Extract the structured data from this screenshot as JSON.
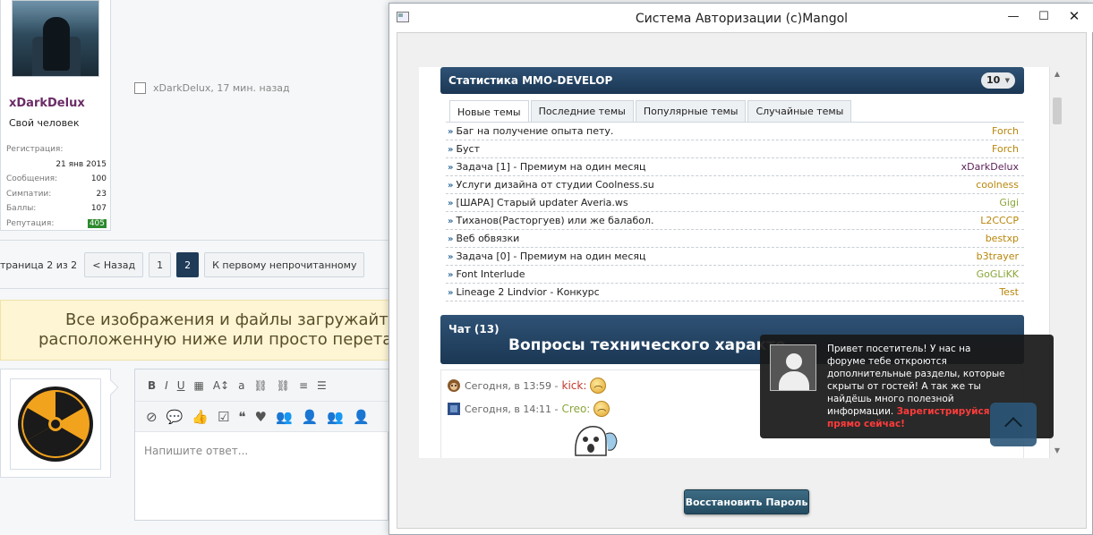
{
  "forum": {
    "user": {
      "name": "xDarkDelux",
      "title": "Свой человек",
      "stats": [
        {
          "label": "Регистрация:",
          "value": ""
        },
        {
          "label": "",
          "value": "21 янв 2015"
        },
        {
          "label": "Сообщения:",
          "value": "100"
        },
        {
          "label": "Симпатии:",
          "value": "23"
        },
        {
          "label": "Баллы:",
          "value": "107"
        },
        {
          "label": "Репутация:",
          "value": "405"
        }
      ]
    },
    "post_meta": "xDarkDelux, 17 мин. назад",
    "pagination": {
      "label": "траница 2 из 2",
      "prev": "< Назад",
      "pages": [
        "1",
        "2"
      ],
      "active_page": "2",
      "first_unread": "К первому непрочитанному"
    },
    "notice": {
      "line1": "Все изображения и файлы загружайте тольк",
      "line2": "расположенную ниже или просто перетащите к"
    },
    "editor": {
      "placeholder": "Напишите ответ..."
    }
  },
  "dialog": {
    "title": "Система Авторизации (c)Mangol",
    "stats_panel": {
      "title": "Статистика MMO-DEVELOP",
      "count": "10"
    },
    "tabs": [
      {
        "label": "Новые темы",
        "active": true
      },
      {
        "label": "Последние темы",
        "active": false
      },
      {
        "label": "Популярные темы",
        "active": false
      },
      {
        "label": "Случайные темы",
        "active": false
      }
    ],
    "topics": [
      {
        "title": "Баг на получение опыта пету.",
        "author": "Forch",
        "color": "#b8860b"
      },
      {
        "title": "Буст",
        "author": "Forch",
        "color": "#b8860b"
      },
      {
        "title": "Задача [1] - Премиум на один месяц",
        "author": "xDarkDelux",
        "color": "#5a1f57"
      },
      {
        "title": "Услуги дизайна от студии Coolness.su",
        "author": "coolness",
        "color": "#b8860b"
      },
      {
        "title": "[ШАРА] Старый updater Averia.ws",
        "author": "Gigi",
        "color": "#8aa63a"
      },
      {
        "title": "Тиханов(Расторгуев) или же балабол.",
        "author": "L2CCCP",
        "color": "#b8860b"
      },
      {
        "title": "Веб обвязки",
        "author": "bestxp",
        "color": "#b8860b"
      },
      {
        "title": "Задача [0] - Премиум на один месяц",
        "author": "b3trayer",
        "color": "#b8860b"
      },
      {
        "title": "Font Interlude",
        "author": "GoGLiKK",
        "color": "#8aa63a"
      },
      {
        "title": "Lineage 2 Lindvior - Конкурс",
        "author": "Test",
        "color": "#b8860b"
      }
    ],
    "chat": {
      "title": "Чат (13)",
      "banner": "Вопросы технического характе",
      "messages": [
        {
          "time": "Сегодня, в 13:59 -",
          "nick": "kick:",
          "nick_color": "#c0392b"
        },
        {
          "time": "Сегодня, в 14:11 -",
          "nick": "Creo:",
          "nick_color": "#8aa63a"
        }
      ]
    },
    "restore_button": "Восстановить Пароль"
  },
  "popup": {
    "text": "Привет посетитель! У нас на форуме тебе откроются дополнительные разделы, которые скрыты от гостей! А так же ты найдёшь много полезной информации.",
    "cta": "Зарегистрируйся прямо сейчас!"
  }
}
